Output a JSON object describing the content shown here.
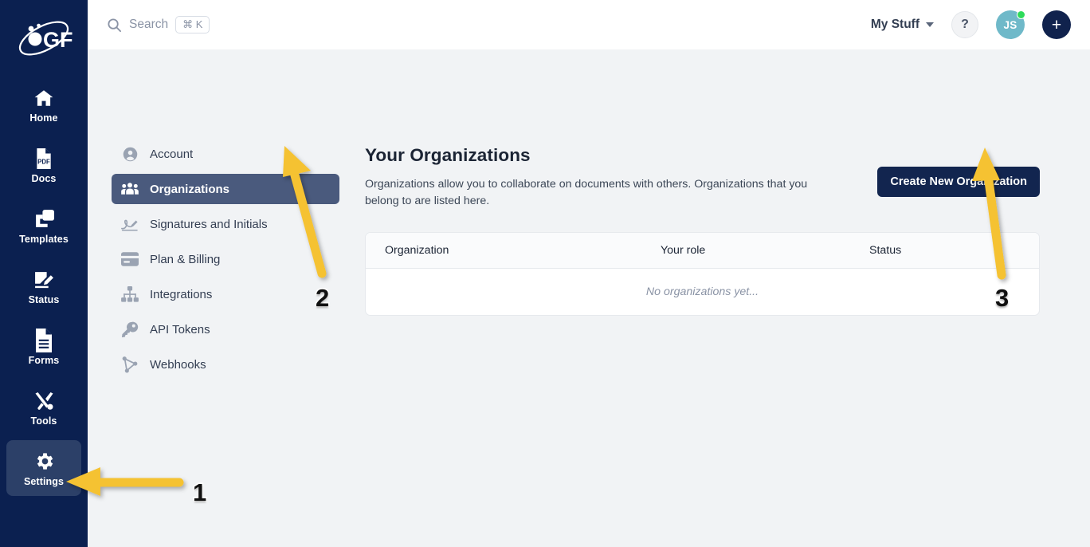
{
  "brand": {
    "logo_text": "GF",
    "navy": "#0b2050",
    "accent_yellow": "#f5c230",
    "active_rail": "#2c4068",
    "active_nav": "#4a5a7d",
    "button_navy": "#12254f"
  },
  "rail": {
    "items": [
      {
        "label": "Home",
        "icon": "home-icon",
        "active": false
      },
      {
        "label": "Docs",
        "icon": "pdf-file-icon",
        "active": false
      },
      {
        "label": "Templates",
        "icon": "templates-icon",
        "active": false
      },
      {
        "label": "Status",
        "icon": "signature-status-icon",
        "active": false
      },
      {
        "label": "Forms",
        "icon": "forms-icon",
        "active": false
      },
      {
        "label": "Tools",
        "icon": "tools-icon",
        "active": false
      },
      {
        "label": "Settings",
        "icon": "gear-icon",
        "active": true
      }
    ]
  },
  "topbar": {
    "search_label": "Search",
    "search_shortcut": "⌘ K",
    "my_stuff_label": "My Stuff",
    "help_label": "?",
    "avatar_initials": "JS",
    "add_label": "+"
  },
  "settings_nav": {
    "items": [
      {
        "label": "Account",
        "icon": "user-circle-icon",
        "active": false
      },
      {
        "label": "Organizations",
        "icon": "people-group-icon",
        "active": true
      },
      {
        "label": "Signatures and Initials",
        "icon": "signature-icon",
        "active": false
      },
      {
        "label": "Plan & Billing",
        "icon": "credit-card-icon",
        "active": false
      },
      {
        "label": "Integrations",
        "icon": "sitemap-icon",
        "active": false
      },
      {
        "label": "API Tokens",
        "icon": "key-icon",
        "active": false
      },
      {
        "label": "Webhooks",
        "icon": "share-nodes-icon",
        "active": false
      }
    ]
  },
  "main": {
    "title": "Your Organizations",
    "description": "Organizations allow you to collaborate on documents with others. Organizations that you belong to are listed here.",
    "create_button": "Create New Organization",
    "table": {
      "columns": [
        "Organization",
        "Your role",
        "Status"
      ],
      "rows": [],
      "empty_message": "No organizations yet..."
    }
  },
  "annotations": [
    {
      "number": "1",
      "target": "settings-rail-item"
    },
    {
      "number": "2",
      "target": "organizations-nav-item"
    },
    {
      "number": "3",
      "target": "create-new-organization-button"
    }
  ]
}
